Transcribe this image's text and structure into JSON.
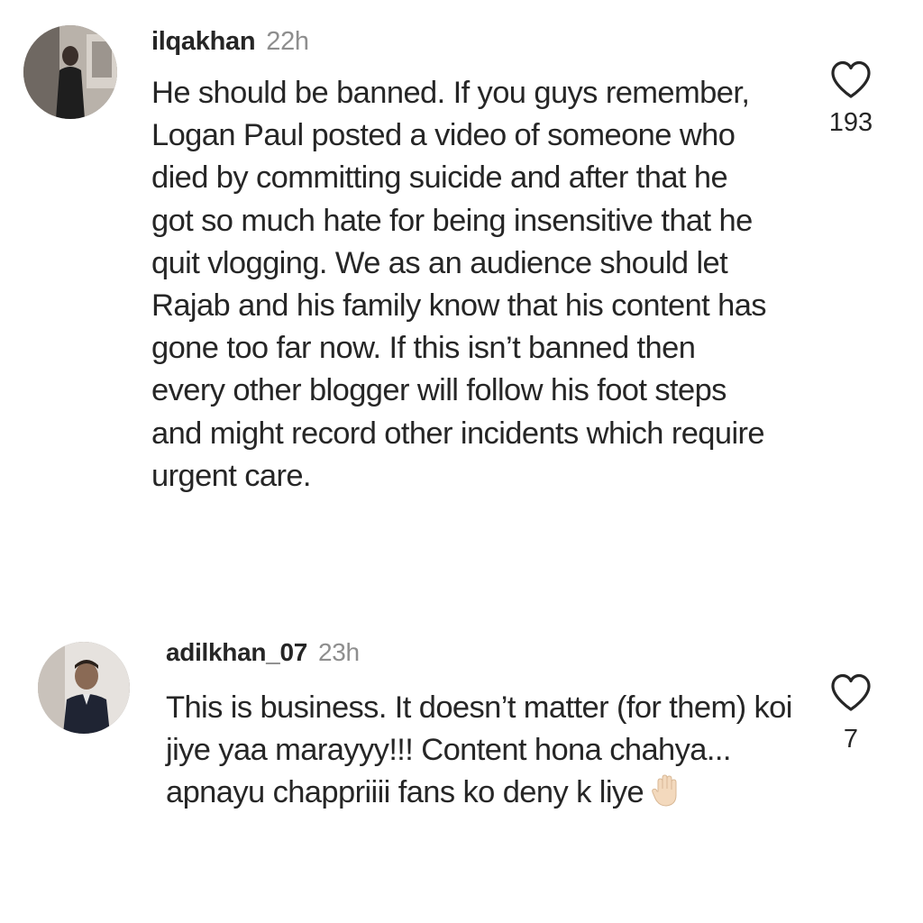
{
  "comments": [
    {
      "username": "ilqakhan",
      "time": "22h",
      "text": "He should be banned. If you guys remember, Logan Paul posted a video of someone who died by committing suicide and after that he got so much hate for being insensitive that he quit vlogging. We as an audience should let Rajab and his family know that his content has gone too far now. If this isn’t banned then every other blogger will follow his foot steps and might record other incidents which require urgent care.",
      "likes": "193",
      "like_icon": "heart-outline-icon"
    },
    {
      "username": "adilkhan_07",
      "time": "23h",
      "text": "This is business. It doesn’t matter (for them) koi jiye yaa marayyy!!! Content hona chahya... apnayu chappriiii fans ko deny k liye",
      "trailing_emoji": "raised-hand-emoji",
      "likes": "7",
      "like_icon": "heart-outline-icon"
    }
  ],
  "colors": {
    "text": "#262626",
    "secondary": "#8e8e8e",
    "background": "#ffffff"
  }
}
